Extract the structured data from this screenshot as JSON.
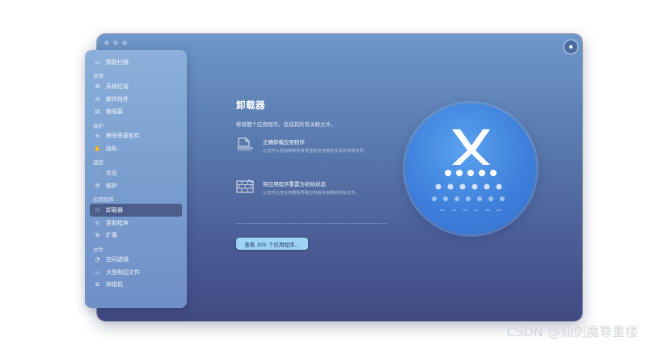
{
  "window": {
    "title": ""
  },
  "sidebar": {
    "groups": [
      {
        "section": "",
        "items": [
          {
            "label": "智能扫描",
            "icon": "monitor-scan-icon"
          }
        ]
      },
      {
        "section": "清理",
        "items": [
          {
            "label": "系统垃圾",
            "icon": "recycle-icon"
          },
          {
            "label": "邮件附件",
            "icon": "envelope-icon"
          },
          {
            "label": "废纸篓",
            "icon": "trash-icon"
          }
        ]
      },
      {
        "section": "保护",
        "items": [
          {
            "label": "移除恶意软件",
            "icon": "biohazard-icon"
          },
          {
            "label": "隐私",
            "icon": "hand-icon"
          }
        ]
      },
      {
        "section": "速度",
        "items": [
          {
            "label": "优化",
            "icon": "sliders-icon"
          },
          {
            "label": "维护",
            "icon": "wrench-icon"
          }
        ]
      },
      {
        "section": "应用程序",
        "items": [
          {
            "label": "卸载器",
            "icon": "uninstaller-icon",
            "active": true
          },
          {
            "label": "更新程序",
            "icon": "update-icon"
          },
          {
            "label": "扩展",
            "icon": "extension-icon"
          }
        ]
      },
      {
        "section": "文件",
        "items": [
          {
            "label": "空间透镜",
            "icon": "lens-icon"
          },
          {
            "label": "大型和旧文件",
            "icon": "folder-icon"
          },
          {
            "label": "碎纸机",
            "icon": "shredder-icon"
          }
        ]
      }
    ]
  },
  "main": {
    "title": "卸载器",
    "subtitle": "移除整个应用程序，包括其所有关联文件。",
    "features": [
      {
        "title": "正确卸载应用程序",
        "desc": "让您可以轻松移除所有类型的应用程序及其所有残余项。",
        "icon": "document-uninstall-icon"
      },
      {
        "title": "将应用程序重置为初始状态",
        "desc": "让您可以安全地删除导致应用程序故障的相关文件。",
        "icon": "brick-wall-icon"
      }
    ],
    "button_label": "查看 305 个应用程序..."
  },
  "colors": {
    "accent": "#9ed3f3",
    "window_top": "#6f97c9",
    "window_bottom": "#414a83",
    "active_item": "#4d5e8c"
  },
  "watermark": "CSDN @仙剑魔尊重楼"
}
